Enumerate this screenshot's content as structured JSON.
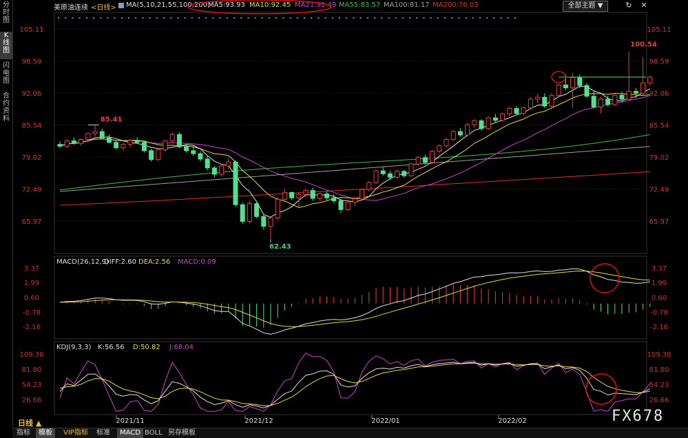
{
  "sidebar": {
    "tabs": [
      {
        "label": "分\n时\n图",
        "active": false
      },
      {
        "label": "K\n线\n图",
        "active": true
      },
      {
        "label": "闪\n电\n图",
        "active": false
      },
      {
        "label": "合\n约\n资\n料",
        "active": false
      }
    ]
  },
  "header": {
    "title": "美原油连续",
    "period": "<日线>",
    "ma_params": "MA(5,10,21,55,100,200)",
    "ma_values": [
      {
        "text": "MA5:93.93",
        "color": "#e0e0e0"
      },
      {
        "text": "MA10:92.45",
        "color": "#e8d840"
      },
      {
        "text": "MA21:91.49",
        "color": "#d040d0"
      },
      {
        "text": "MA55:83.57",
        "color": "#40c040"
      },
      {
        "text": "MA100:81.17",
        "color": "#a0a0a0"
      },
      {
        "text": "MA200:76.03",
        "color": "#e03030"
      }
    ],
    "theme_button": "全部主题 ▼",
    "win_buttons": [
      "↻",
      "✕"
    ]
  },
  "price_axis": {
    "ticks": [
      "105.11",
      "98.59",
      "92.06",
      "85.54",
      "79.02",
      "72.49",
      "65.97"
    ]
  },
  "price_labels": {
    "high_early": "85.41",
    "low": "62.43",
    "high": "100.54"
  },
  "macd": {
    "header": "MACD(26,12,9)",
    "values": [
      {
        "text": "DIFF:2.60",
        "color": "#e0e0e0"
      },
      {
        "text": "DEA:2.56",
        "color": "#e8d840"
      },
      {
        "text": "MACD:0.09",
        "color": "#d040d0"
      }
    ],
    "ticks": [
      "3.37",
      "1.99",
      "0.60",
      "-0.78",
      "-2.16"
    ]
  },
  "kdj": {
    "header": "KDJ(9,3,3)",
    "values": [
      {
        "text": "K:56.56",
        "color": "#e0e0e0"
      },
      {
        "text": "D:50.82",
        "color": "#e8d840"
      },
      {
        "text": "J:68.04",
        "color": "#d040d0"
      }
    ],
    "ticks": [
      "109.38",
      "81.80",
      "54.23",
      "26.66"
    ]
  },
  "x_axis": {
    "labels": [
      "2021/11",
      "2021/12",
      "2022/01",
      "2022/02"
    ]
  },
  "period_selector": "日线 ▲",
  "bottom_tabs": [
    "指标",
    "模板",
    "VIP指标",
    "标准",
    "MACD",
    "BOLL",
    "另存模板"
  ],
  "watermark": "FX678",
  "colors": {
    "up": "#e84040",
    "down": "#50e090",
    "grid": "#2a2a2a",
    "axis_text_price": "#e03030",
    "axis_text_ind": "#d03030",
    "annotation": "#e01010"
  },
  "chart_data": {
    "type": "candlestick",
    "title": "美原油连续 <日线>",
    "ylim": [
      62.0,
      105.5
    ],
    "candles_ohlc": [
      [
        81.6,
        82.2,
        80.9,
        81.2
      ],
      [
        81.2,
        82.6,
        80.8,
        82.3
      ],
      [
        82.3,
        83.0,
        81.5,
        81.8
      ],
      [
        81.8,
        82.8,
        81.3,
        82.6
      ],
      [
        82.6,
        84.0,
        82.0,
        83.8
      ],
      [
        83.8,
        85.4,
        83.2,
        84.2
      ],
      [
        84.2,
        84.8,
        82.6,
        82.9
      ],
      [
        82.9,
        83.6,
        81.8,
        82.0
      ],
      [
        82.0,
        82.5,
        80.6,
        80.9
      ],
      [
        80.9,
        81.9,
        80.3,
        81.6
      ],
      [
        81.6,
        82.7,
        81.0,
        82.4
      ],
      [
        82.4,
        83.1,
        81.7,
        82.0
      ],
      [
        82.0,
        82.4,
        79.9,
        80.3
      ],
      [
        80.3,
        80.7,
        78.1,
        78.5
      ],
      [
        78.5,
        80.9,
        78.2,
        80.5
      ],
      [
        80.5,
        82.5,
        80.1,
        82.3
      ],
      [
        82.3,
        84.0,
        81.8,
        83.6
      ],
      [
        83.6,
        84.1,
        80.8,
        81.1
      ],
      [
        81.1,
        81.7,
        79.9,
        80.3
      ],
      [
        80.3,
        81.3,
        79.3,
        79.7
      ],
      [
        79.7,
        80.2,
        78.1,
        78.6
      ],
      [
        78.6,
        79.4,
        76.3,
        76.8
      ],
      [
        76.8,
        77.2,
        74.9,
        75.5
      ],
      [
        75.5,
        77.6,
        75.0,
        77.2
      ],
      [
        77.2,
        78.8,
        76.5,
        78.0
      ],
      [
        78.0,
        78.4,
        68.9,
        69.3
      ],
      [
        69.3,
        69.8,
        65.4,
        65.9
      ],
      [
        65.9,
        70.1,
        65.5,
        69.5
      ],
      [
        69.5,
        70.0,
        66.5,
        66.9
      ],
      [
        66.9,
        67.3,
        64.2,
        64.9
      ],
      [
        64.9,
        67.0,
        62.4,
        66.6
      ],
      [
        66.6,
        70.9,
        66.1,
        70.4
      ],
      [
        70.4,
        72.5,
        69.8,
        71.8
      ],
      [
        71.8,
        72.0,
        70.3,
        70.7
      ],
      [
        70.7,
        71.9,
        68.9,
        71.4
      ],
      [
        71.4,
        72.6,
        70.8,
        72.2
      ],
      [
        72.2,
        72.8,
        70.1,
        70.6
      ],
      [
        70.6,
        71.8,
        70.0,
        71.5
      ],
      [
        71.5,
        72.1,
        70.2,
        70.7
      ],
      [
        70.7,
        71.5,
        69.6,
        70.1
      ],
      [
        70.1,
        70.6,
        67.6,
        68.3
      ],
      [
        68.3,
        70.2,
        68.0,
        69.8
      ],
      [
        69.8,
        70.9,
        69.0,
        70.5
      ],
      [
        70.5,
        72.6,
        70.2,
        72.4
      ],
      [
        72.4,
        74.1,
        72.0,
        73.8
      ],
      [
        73.8,
        76.5,
        73.5,
        76.2
      ],
      [
        76.2,
        76.9,
        75.2,
        75.6
      ],
      [
        75.6,
        76.2,
        74.3,
        74.9
      ],
      [
        74.9,
        76.5,
        74.5,
        76.1
      ],
      [
        76.1,
        76.4,
        74.8,
        75.2
      ],
      [
        75.2,
        77.9,
        75.0,
        77.6
      ],
      [
        77.6,
        79.3,
        77.2,
        78.9
      ],
      [
        78.9,
        79.5,
        77.5,
        77.9
      ],
      [
        77.9,
        80.5,
        77.6,
        80.2
      ],
      [
        80.2,
        81.6,
        79.8,
        81.3
      ],
      [
        81.3,
        83.0,
        80.9,
        82.6
      ],
      [
        82.6,
        84.5,
        82.3,
        84.2
      ],
      [
        84.2,
        84.9,
        83.1,
        83.5
      ],
      [
        83.5,
        85.9,
        83.2,
        85.6
      ],
      [
        85.6,
        86.8,
        85.0,
        86.4
      ],
      [
        86.4,
        86.7,
        84.4,
        84.8
      ],
      [
        84.8,
        87.3,
        84.5,
        87.0
      ],
      [
        87.0,
        87.8,
        86.1,
        86.5
      ],
      [
        86.5,
        88.1,
        86.2,
        87.8
      ],
      [
        87.8,
        89.3,
        87.2,
        88.9
      ],
      [
        88.9,
        89.4,
        87.5,
        87.9
      ],
      [
        87.9,
        89.3,
        87.5,
        89.0
      ],
      [
        89.0,
        91.2,
        88.7,
        90.8
      ],
      [
        90.8,
        91.8,
        90.0,
        91.2
      ],
      [
        91.2,
        92.0,
        89.0,
        89.4
      ],
      [
        89.4,
        91.9,
        89.0,
        91.6
      ],
      [
        91.6,
        94.0,
        91.3,
        93.7
      ],
      [
        93.7,
        95.8,
        92.6,
        93.1
      ],
      [
        93.1,
        96.2,
        89.0,
        95.2
      ],
      [
        95.2,
        95.8,
        93.0,
        93.6
      ],
      [
        93.6,
        94.1,
        91.0,
        91.4
      ],
      [
        91.4,
        92.5,
        88.9,
        89.2
      ],
      [
        89.2,
        91.3,
        87.9,
        90.8
      ],
      [
        90.8,
        91.5,
        89.3,
        89.7
      ],
      [
        89.7,
        91.9,
        89.4,
        91.6
      ],
      [
        91.6,
        92.4,
        90.3,
        90.8
      ],
      [
        90.8,
        100.5,
        90.5,
        92.4
      ],
      [
        92.4,
        93.1,
        91.0,
        92.0
      ],
      [
        92.0,
        99.4,
        91.6,
        94.1
      ],
      [
        94.1,
        95.6,
        93.5,
        95.3
      ]
    ],
    "ma_lines": [
      {
        "name": "MA5",
        "color": "#e0e0e0",
        "last": 93.93
      },
      {
        "name": "MA10",
        "color": "#e8d840",
        "last": 92.45
      },
      {
        "name": "MA21",
        "color": "#d040d0",
        "last": 91.49
      },
      {
        "name": "MA55",
        "color": "#40c040",
        "last": 83.57
      },
      {
        "name": "MA100",
        "color": "#a0a0a0",
        "last": 81.17
      },
      {
        "name": "MA200",
        "color": "#e03030",
        "last": 76.03
      }
    ],
    "reference_level": 95.3,
    "macd_ylim": [
      -3.5,
      3.7
    ],
    "kdj_ylim": [
      5,
      112
    ]
  }
}
